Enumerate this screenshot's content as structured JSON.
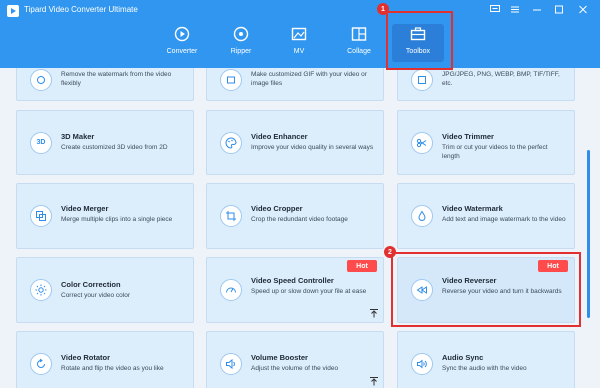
{
  "app": {
    "title": "Tipard Video Converter Ultimate"
  },
  "window_controls": [
    {
      "name": "feedback-icon"
    },
    {
      "name": "menu-icon"
    },
    {
      "name": "minimize-icon"
    },
    {
      "name": "maximize-icon"
    },
    {
      "name": "close-icon"
    }
  ],
  "nav": {
    "items": [
      {
        "label": "Converter",
        "icon": "converter-icon"
      },
      {
        "label": "Ripper",
        "icon": "ripper-icon"
      },
      {
        "label": "MV",
        "icon": "mv-icon"
      },
      {
        "label": "Collage",
        "icon": "collage-icon"
      },
      {
        "label": "Toolbox",
        "icon": "toolbox-icon",
        "active": true
      }
    ]
  },
  "markers": {
    "one": "1",
    "two": "2"
  },
  "tools": {
    "partial_top": [
      {
        "desc": "Remove the watermark from the video flexibly"
      },
      {
        "desc": "Make customized GIF with your video or image files"
      },
      {
        "desc": "JPG/JPEG, PNG, WEBP, BMP, TIF/TIFF, etc."
      }
    ],
    "row1": [
      {
        "title": "3D Maker",
        "desc": "Create customized 3D video from 2D",
        "icon": "3d-icon",
        "icon_text": "3D"
      },
      {
        "title": "Video Enhancer",
        "desc": "Improve your video quality in several ways",
        "icon": "palette-icon"
      },
      {
        "title": "Video Trimmer",
        "desc": "Trim or cut your videos to the perfect length",
        "icon": "scissors-icon"
      }
    ],
    "row2": [
      {
        "title": "Video Merger",
        "desc": "Merge multiple clips into a single piece",
        "icon": "merge-icon"
      },
      {
        "title": "Video Cropper",
        "desc": "Crop the redundant video footage",
        "icon": "crop-icon"
      },
      {
        "title": "Video Watermark",
        "desc": "Add text and image watermark to the video",
        "icon": "droplet-icon"
      }
    ],
    "row3": [
      {
        "title": "Color Correction",
        "desc": "Correct your video color",
        "icon": "sun-icon"
      },
      {
        "title": "Video Speed Controller",
        "desc": "Speed up or slow down your file at ease",
        "icon": "speedometer-icon",
        "badge": "Hot"
      },
      {
        "title": "Video Reverser",
        "desc": "Reverse your video and turn it backwards",
        "icon": "rewind-icon",
        "badge": "Hot"
      }
    ],
    "row4": [
      {
        "title": "Video Rotator",
        "desc": "Rotate and flip the video as you like",
        "icon": "rotate-icon"
      },
      {
        "title": "Volume Booster",
        "desc": "Adjust the volume of the video",
        "icon": "speaker-icon"
      },
      {
        "title": "Audio Sync",
        "desc": "Sync the audio with the video",
        "icon": "audio-sync-icon"
      }
    ]
  },
  "colors": {
    "header": "#3196ef",
    "card": "#dcedfb",
    "highlight": "#e23030",
    "hot_badge": "#ff4b4b",
    "scrollbar": "#2f8ee8"
  }
}
